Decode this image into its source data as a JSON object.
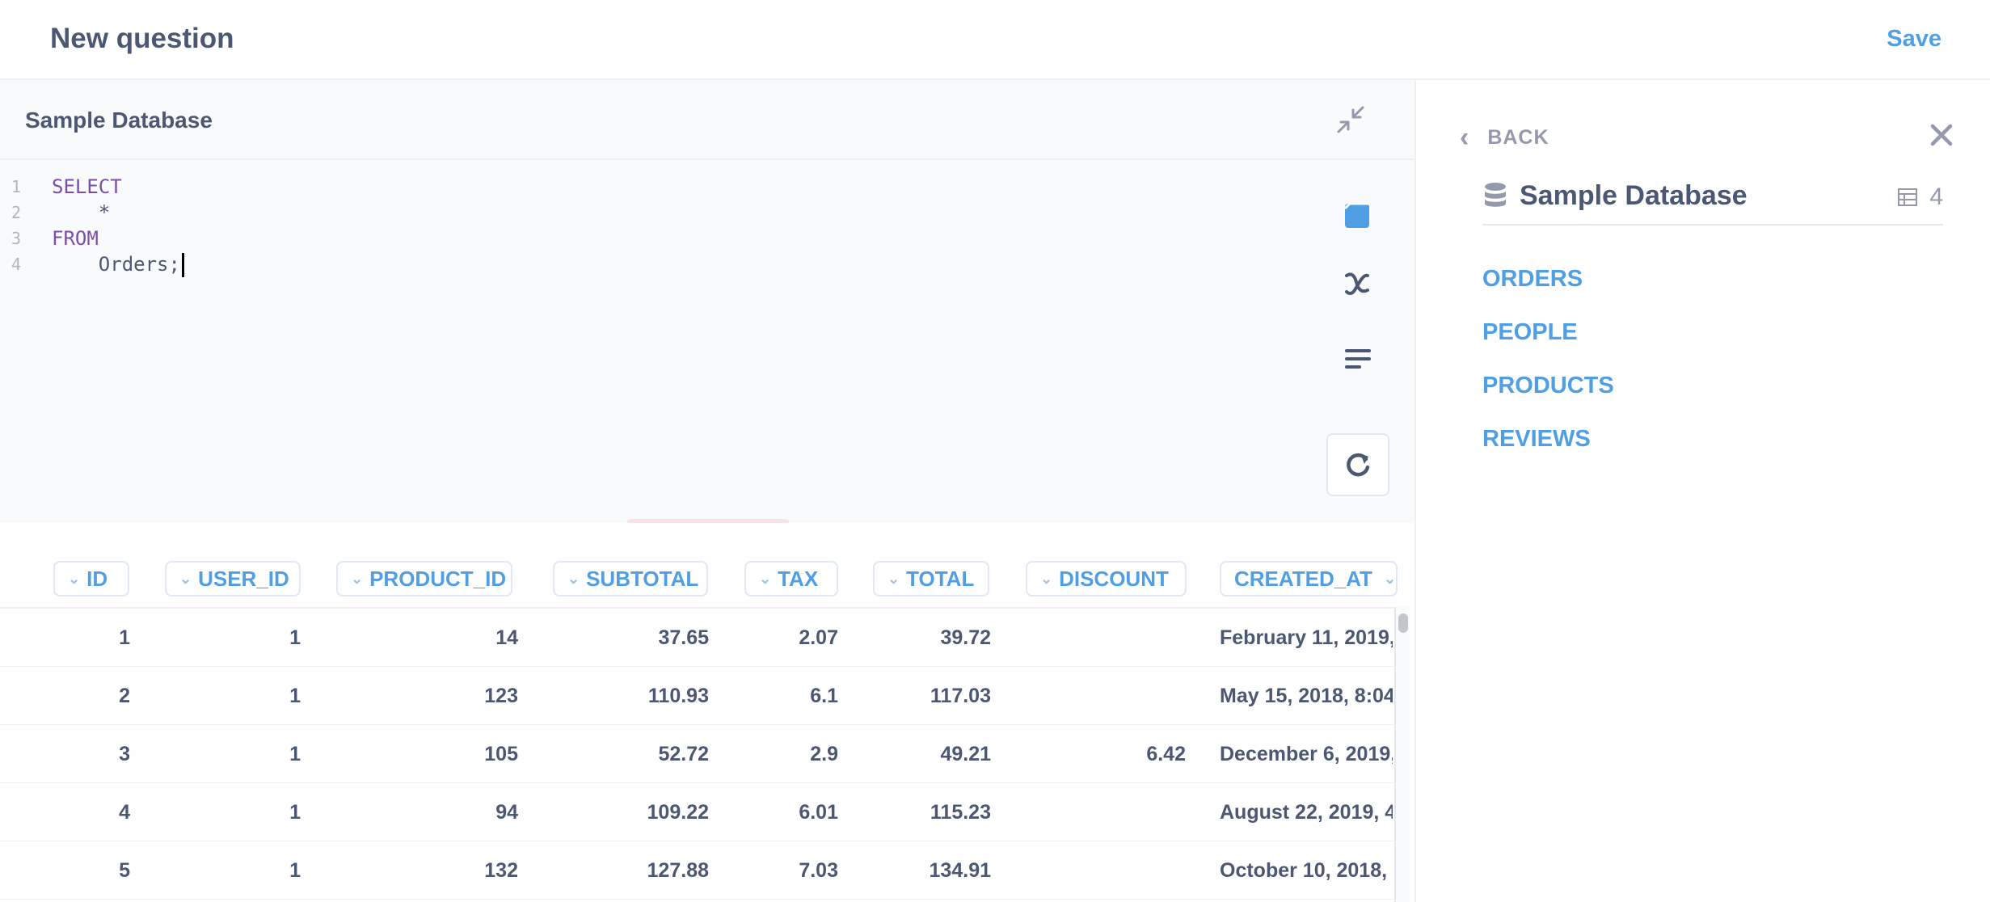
{
  "header": {
    "title": "New question",
    "save_label": "Save"
  },
  "editor": {
    "database": "Sample Database",
    "lines": [
      {
        "num": "1",
        "kw": "SELECT",
        "text": ""
      },
      {
        "num": "2",
        "kw": "",
        "text": "    *"
      },
      {
        "num": "3",
        "kw": "FROM",
        "text": ""
      },
      {
        "num": "4",
        "kw": "",
        "text": "    Orders;"
      }
    ]
  },
  "table": {
    "columns": [
      "ID",
      "USER_ID",
      "PRODUCT_ID",
      "SUBTOTAL",
      "TAX",
      "TOTAL",
      "DISCOUNT",
      "CREATED_AT"
    ],
    "rows": [
      [
        "1",
        "1",
        "14",
        "37.65",
        "2.07",
        "39.72",
        "",
        "February 11, 2019,"
      ],
      [
        "2",
        "1",
        "123",
        "110.93",
        "6.1",
        "117.03",
        "",
        "May 15, 2018, 8:04"
      ],
      [
        "3",
        "1",
        "105",
        "52.72",
        "2.9",
        "49.21",
        "6.42",
        "December 6, 2019,"
      ],
      [
        "4",
        "1",
        "94",
        "109.22",
        "6.01",
        "115.23",
        "",
        "August 22, 2019, 4:"
      ],
      [
        "5",
        "1",
        "132",
        "127.88",
        "7.03",
        "134.91",
        "",
        "October 10, 2018, 3"
      ]
    ]
  },
  "sidebar": {
    "back_label": "BACK",
    "database": "Sample Database",
    "table_count": "4",
    "tables": [
      "ORDERS",
      "PEOPLE",
      "PRODUCTS",
      "REVIEWS"
    ]
  },
  "colors": {
    "accent": "#509ee3",
    "text": "#4c5773",
    "muted": "#949aab",
    "keyword": "#7b4fa8"
  }
}
